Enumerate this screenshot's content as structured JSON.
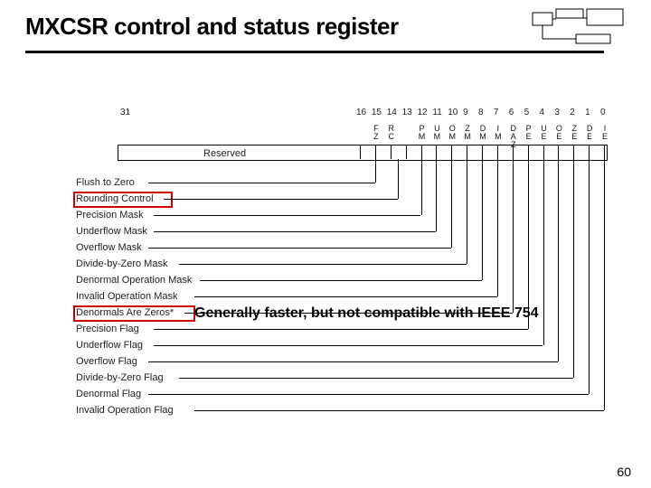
{
  "title": "MXCSR control and status register",
  "pagenum": "60",
  "reserved": "Reserved",
  "bit_high": "31",
  "bit_cols": [
    "16",
    "15",
    "14",
    "13",
    "12",
    "11",
    "10",
    "9",
    "8",
    "7",
    "6",
    "5",
    "4",
    "3",
    "2",
    "1",
    "0"
  ],
  "col_heads": [
    "F\nZ",
    "R\nC",
    "",
    "P\nM",
    "U\nM",
    "O\nM",
    "Z\nM",
    "D\nM",
    "I\nM",
    "D\nA\nZ",
    "P\nE",
    "U\nE",
    "O\nE",
    "Z\nE",
    "D\nE",
    "I\nE"
  ],
  "fields": [
    "Flush to Zero",
    "Rounding Control",
    "Precision Mask",
    "Underflow Mask",
    "Overflow Mask",
    "Divide-by-Zero Mask",
    "Denormal Operation Mask",
    "Invalid Operation Mask",
    "Denormals Are Zeros*",
    "Precision Flag",
    "Underflow Flag",
    "Overflow Flag",
    "Divide-by-Zero Flag",
    "Denormal Flag",
    "Invalid Operation Flag"
  ],
  "annotation": "Generally faster, but not compatible with IEEE 754",
  "chart_data": {
    "type": "table",
    "title": "MXCSR control and status register",
    "register_width": 32,
    "bits": {
      "31-16": "Reserved",
      "15": {
        "code": "FZ",
        "name": "Flush to Zero"
      },
      "14-13": {
        "code": "RC",
        "name": "Rounding Control"
      },
      "12": {
        "code": "PM",
        "name": "Precision Mask"
      },
      "11": {
        "code": "UM",
        "name": "Underflow Mask"
      },
      "10": {
        "code": "OM",
        "name": "Overflow Mask"
      },
      "9": {
        "code": "ZM",
        "name": "Divide-by-Zero Mask"
      },
      "8": {
        "code": "DM",
        "name": "Denormal Operation Mask"
      },
      "7": {
        "code": "IM",
        "name": "Invalid Operation Mask"
      },
      "6": {
        "code": "DAZ",
        "name": "Denormals Are Zeros"
      },
      "5": {
        "code": "PE",
        "name": "Precision Flag"
      },
      "4": {
        "code": "UE",
        "name": "Underflow Flag"
      },
      "3": {
        "code": "OE",
        "name": "Overflow Flag"
      },
      "2": {
        "code": "ZE",
        "name": "Divide-by-Zero Flag"
      },
      "1": {
        "code": "DE",
        "name": "Denormal Flag"
      },
      "0": {
        "code": "IE",
        "name": "Invalid Operation Flag"
      }
    },
    "highlighted": [
      "Rounding Control",
      "Denormals Are Zeros"
    ],
    "annotation": "Generally faster, but not compatible with IEEE 754"
  }
}
